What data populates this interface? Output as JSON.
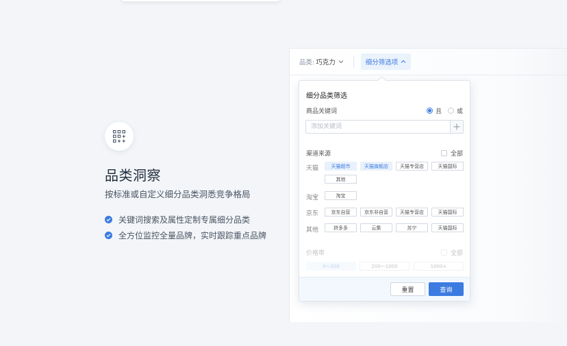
{
  "hero": {
    "icon": "grid-plus-icon",
    "title": "品类洞察",
    "subtitle": "按标准或自定义细分品类洞悉竞争格局",
    "features": [
      "关键词搜索及属性定制专属细分品类",
      "全方位监控全量品牌，实时跟踪重点品牌"
    ]
  },
  "filter_bar": {
    "category_label": "品类:",
    "category_value": "巧克力",
    "sub_filter_label": "细分筛选项"
  },
  "dropdown": {
    "title": "细分品类筛选",
    "keyword_label": "商品关键词",
    "logic_options": [
      "且",
      "或"
    ],
    "logic_selected": "且",
    "keyword_placeholder": "添加关键词",
    "channel_label": "渠道来源",
    "all_label": "全部",
    "channels": [
      {
        "name": "天猫",
        "tags": [
          {
            "label": "天猫超市",
            "selected": true
          },
          {
            "label": "天猫旗舰店",
            "selected": true
          },
          {
            "label": "天猫专营店",
            "selected": false
          },
          {
            "label": "天猫国际",
            "selected": false
          },
          {
            "label": "其他",
            "selected": false
          }
        ]
      },
      {
        "name": "淘宝",
        "tags": [
          {
            "label": "淘宝",
            "selected": false
          }
        ]
      },
      {
        "name": "京东",
        "tags": [
          {
            "label": "京东自营",
            "selected": false
          },
          {
            "label": "京东非自营",
            "selected": false
          },
          {
            "label": "天猫专营店",
            "selected": false
          },
          {
            "label": "天猫国际",
            "selected": false
          }
        ]
      },
      {
        "name": "其他",
        "tags": [
          {
            "label": "拼多多",
            "selected": false
          },
          {
            "label": "云集",
            "selected": false
          },
          {
            "label": "苏宁",
            "selected": false
          },
          {
            "label": "天猫国际",
            "selected": false
          }
        ]
      }
    ],
    "price_label": "价格带",
    "price_all_label": "全部",
    "price_tags": [
      "0～200",
      "200～1000",
      "1000+"
    ],
    "reset_label": "重置",
    "query_label": "查询"
  },
  "colors": {
    "accent": "#3c7be0",
    "background": "#f3f5f8"
  }
}
